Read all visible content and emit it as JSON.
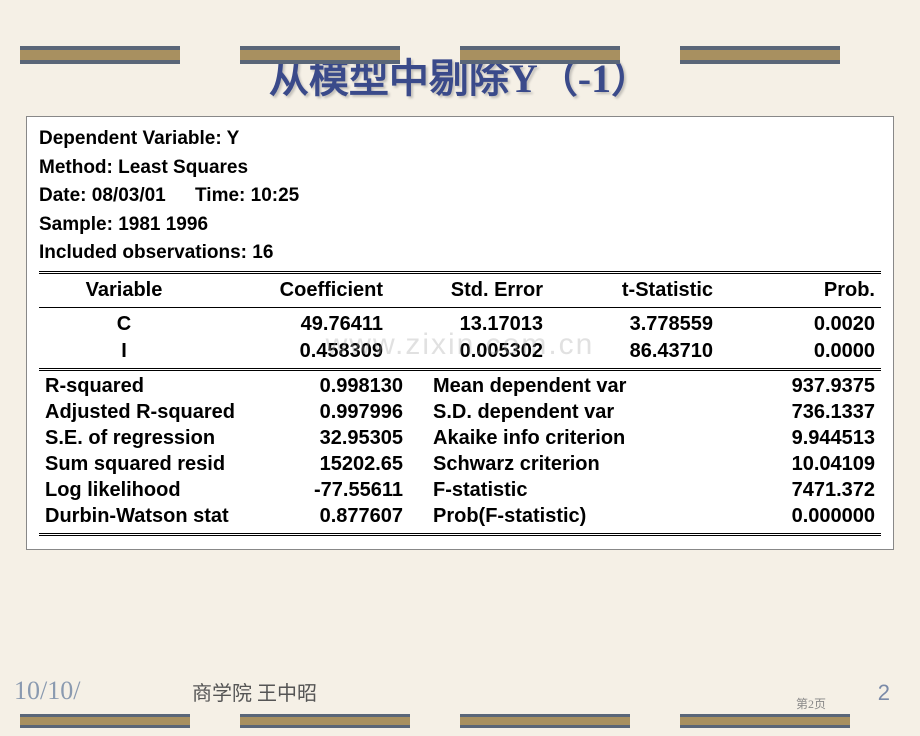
{
  "title": "从模型中剔除Y（-1）",
  "watermark": "www.zixin.com.cn",
  "header": {
    "dep_var": "Dependent Variable: Y",
    "method": "Method: Least Squares",
    "date": "Date: 08/03/01",
    "time": "Time: 10:25",
    "sample": "Sample: 1981 1996",
    "included": "Included observations: 16"
  },
  "columns": {
    "variable": "Variable",
    "coefficient": "Coefficient",
    "std_error": "Std. Error",
    "t_statistic": "t-Statistic",
    "prob": "Prob."
  },
  "rows": [
    {
      "variable": "C",
      "coefficient": "49.76411",
      "std_error": "13.17013",
      "t_statistic": "3.778559",
      "prob": "0.0020"
    },
    {
      "variable": "I",
      "coefficient": "0.458309",
      "std_error": "0.005302",
      "t_statistic": "86.43710",
      "prob": "0.0000"
    }
  ],
  "stats": [
    {
      "l1": "R-squared",
      "v1": "0.998130",
      "l2": "Mean dependent var",
      "v2": "937.9375"
    },
    {
      "l1": "Adjusted R-squared",
      "v1": "0.997996",
      "l2": "S.D. dependent var",
      "v2": "736.1337"
    },
    {
      "l1": "S.E. of regression",
      "v1": "32.95305",
      "l2": "Akaike info criterion",
      "v2": "9.944513"
    },
    {
      "l1": "Sum squared resid",
      "v1": "15202.65",
      "l2": "Schwarz criterion",
      "v2": "10.04109"
    },
    {
      "l1": "Log likelihood",
      "v1": "-77.55611",
      "l2": "F-statistic",
      "v2": "7471.372"
    },
    {
      "l1": "Durbin-Watson stat",
      "v1": "0.877607",
      "l2": "Prob(F-statistic)",
      "v2": "0.000000"
    }
  ],
  "footer": {
    "date": "10/10/",
    "author": "商学院 王中昭",
    "page_small": "第2页",
    "page_main": "2"
  }
}
